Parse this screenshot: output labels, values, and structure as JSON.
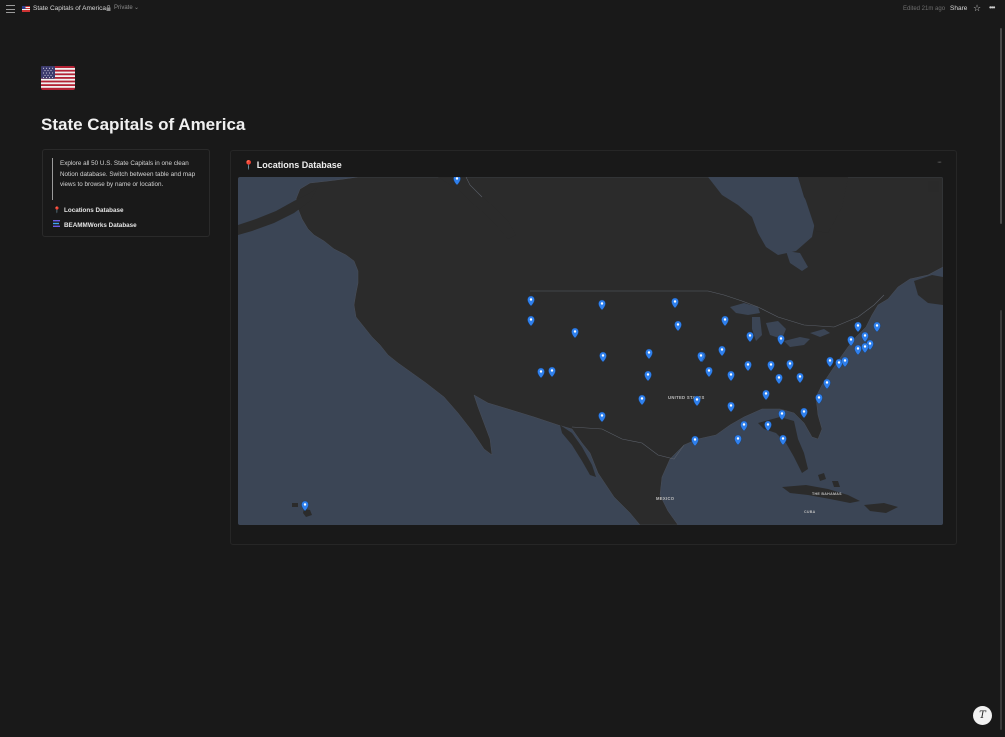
{
  "topbar": {
    "page_title": "State Capitals of America",
    "privacy": "Private",
    "edited": "Edited 21m ago",
    "share_label": "Share",
    "icons": [
      "menu-icon",
      "flag-icon",
      "lock-icon",
      "chevron-down-icon",
      "star-icon",
      "more-icon"
    ]
  },
  "page": {
    "title": "State Capitals of America",
    "icon": "us-flag-icon"
  },
  "callout": {
    "text": "Explore all 50 U.S. State Capitals in one clean Notion database. Switch between table and map views to browse by name or location.",
    "links": [
      {
        "label": "Locations Database",
        "icon": "pushpin-icon"
      },
      {
        "label": "BEAMMWorks Database",
        "icon": "database-icon"
      }
    ]
  },
  "database": {
    "title": "Locations Database",
    "icon": "pushpin-icon",
    "more_label": "···"
  },
  "map": {
    "labels": {
      "country": "UNITED STATES",
      "mexico": "MEXICO",
      "bahamas": "THE BAHAMAS",
      "cuba": "CUBA"
    },
    "marker_color": "#2f80ed",
    "land_color": "#2b2b2b",
    "water_color": "#3b4555"
  },
  "fab": {
    "label": "T"
  },
  "colors": {
    "background": "#191919",
    "accent": "#2f80ed"
  }
}
